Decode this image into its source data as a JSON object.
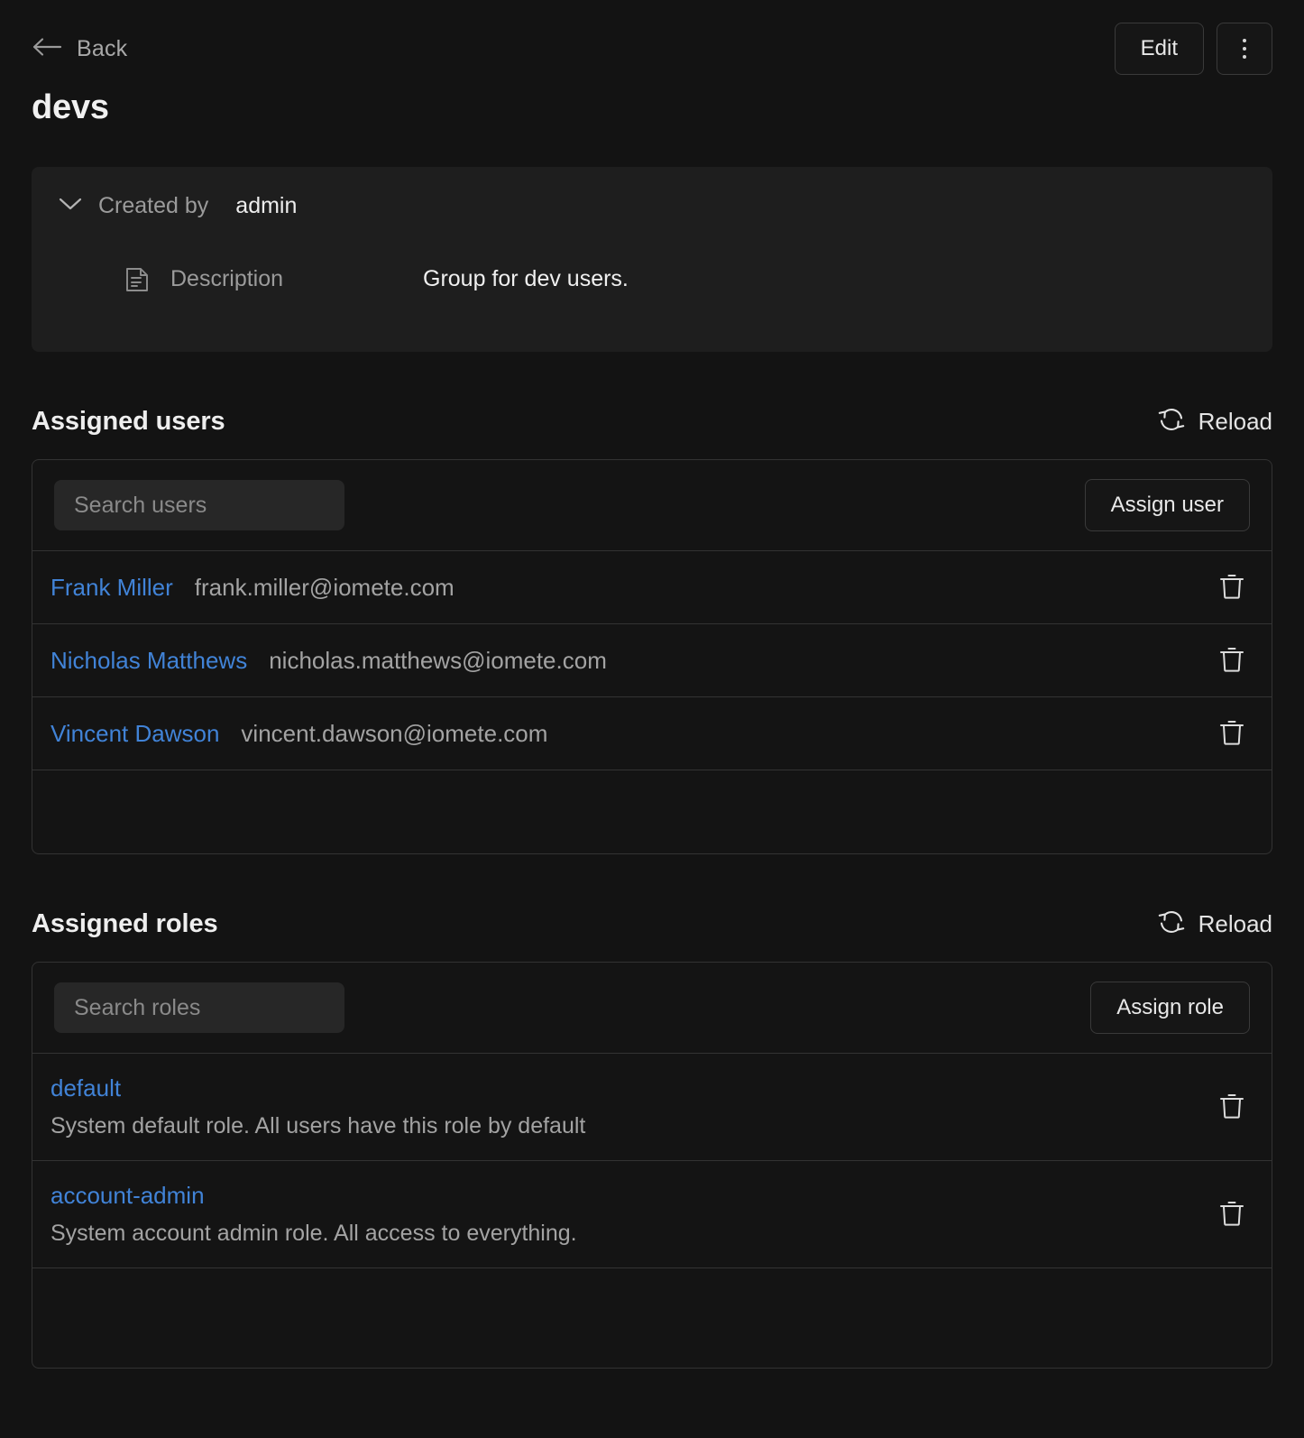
{
  "topbar": {
    "back_label": "Back",
    "edit_label": "Edit",
    "more_label": "More options"
  },
  "page_title": "devs",
  "info_card": {
    "created_by_label": "Created by",
    "created_by_value": "admin",
    "description_label": "Description",
    "description_value": "Group for dev users."
  },
  "users_section": {
    "title": "Assigned users",
    "reload_label": "Reload",
    "search_placeholder": "Search users",
    "assign_label": "Assign user",
    "rows": [
      {
        "name": "Frank Miller",
        "email": "frank.miller@iomete.com"
      },
      {
        "name": "Nicholas Matthews",
        "email": "nicholas.matthews@iomete.com"
      },
      {
        "name": "Vincent Dawson",
        "email": "vincent.dawson@iomete.com"
      }
    ]
  },
  "roles_section": {
    "title": "Assigned roles",
    "reload_label": "Reload",
    "search_placeholder": "Search roles",
    "assign_label": "Assign role",
    "rows": [
      {
        "name": "default",
        "description": "System default role. All users have this role by default"
      },
      {
        "name": "account-admin",
        "description": "System account admin role. All access to everything."
      }
    ]
  },
  "colors": {
    "page_background": "#131313",
    "card_background": "#1e1e1e",
    "panel_background": "#141414",
    "border": "#333333",
    "link": "#4183d7",
    "text_primary": "#eeeeee",
    "text_muted": "#a3a3a3"
  },
  "icons": {
    "back": "arrow-left-icon",
    "more": "kebab-menu-icon",
    "collapse": "chevron-down-icon",
    "description": "document-icon",
    "reload": "refresh-icon",
    "delete": "trash-icon"
  }
}
